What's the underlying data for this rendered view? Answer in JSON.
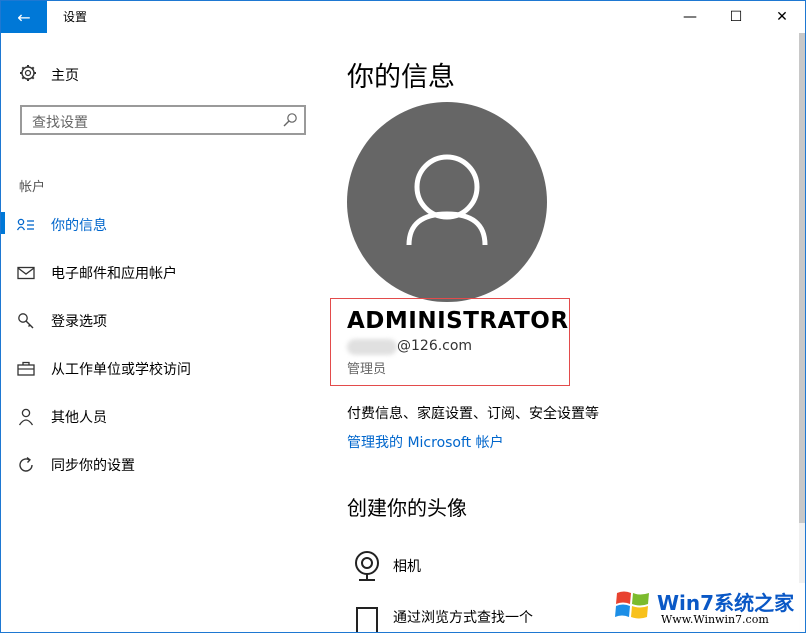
{
  "window": {
    "title": "设置",
    "back_glyph": "←",
    "min_glyph": "—",
    "max_glyph": "☐",
    "close_glyph": "✕"
  },
  "sidebar": {
    "home_label": "主页",
    "search_placeholder": "查找设置",
    "section": "帐户",
    "items": [
      {
        "label": "你的信息",
        "icon": "user-info-icon",
        "active": true
      },
      {
        "label": "电子邮件和应用帐户",
        "icon": "mail-icon"
      },
      {
        "label": "登录选项",
        "icon": "key-icon"
      },
      {
        "label": "从工作单位或学校访问",
        "icon": "briefcase-icon"
      },
      {
        "label": "其他人员",
        "icon": "person-icon"
      },
      {
        "label": "同步你的设置",
        "icon": "sync-icon"
      }
    ]
  },
  "main": {
    "title": "你的信息",
    "user_name": "ADMINISTRATOR",
    "email": "@126.com",
    "role": "管理员",
    "billing_text": "付费信息、家庭设置、订阅、安全设置等",
    "ms_link": "管理我的 Microsoft 帐户",
    "avatar_section_title": "创建你的头像",
    "options": [
      {
        "label": "相机",
        "icon": "camera-icon"
      },
      {
        "label": "通过浏览方式查找一个",
        "icon": "browse-icon"
      }
    ]
  },
  "watermark": {
    "title": "Win7系统之家",
    "url": "Www.Winwin7.com"
  },
  "colors": {
    "accent": "#0078d7",
    "link": "#0066cc",
    "avatar_bg": "#666666",
    "highlight": "#e34b4b"
  }
}
